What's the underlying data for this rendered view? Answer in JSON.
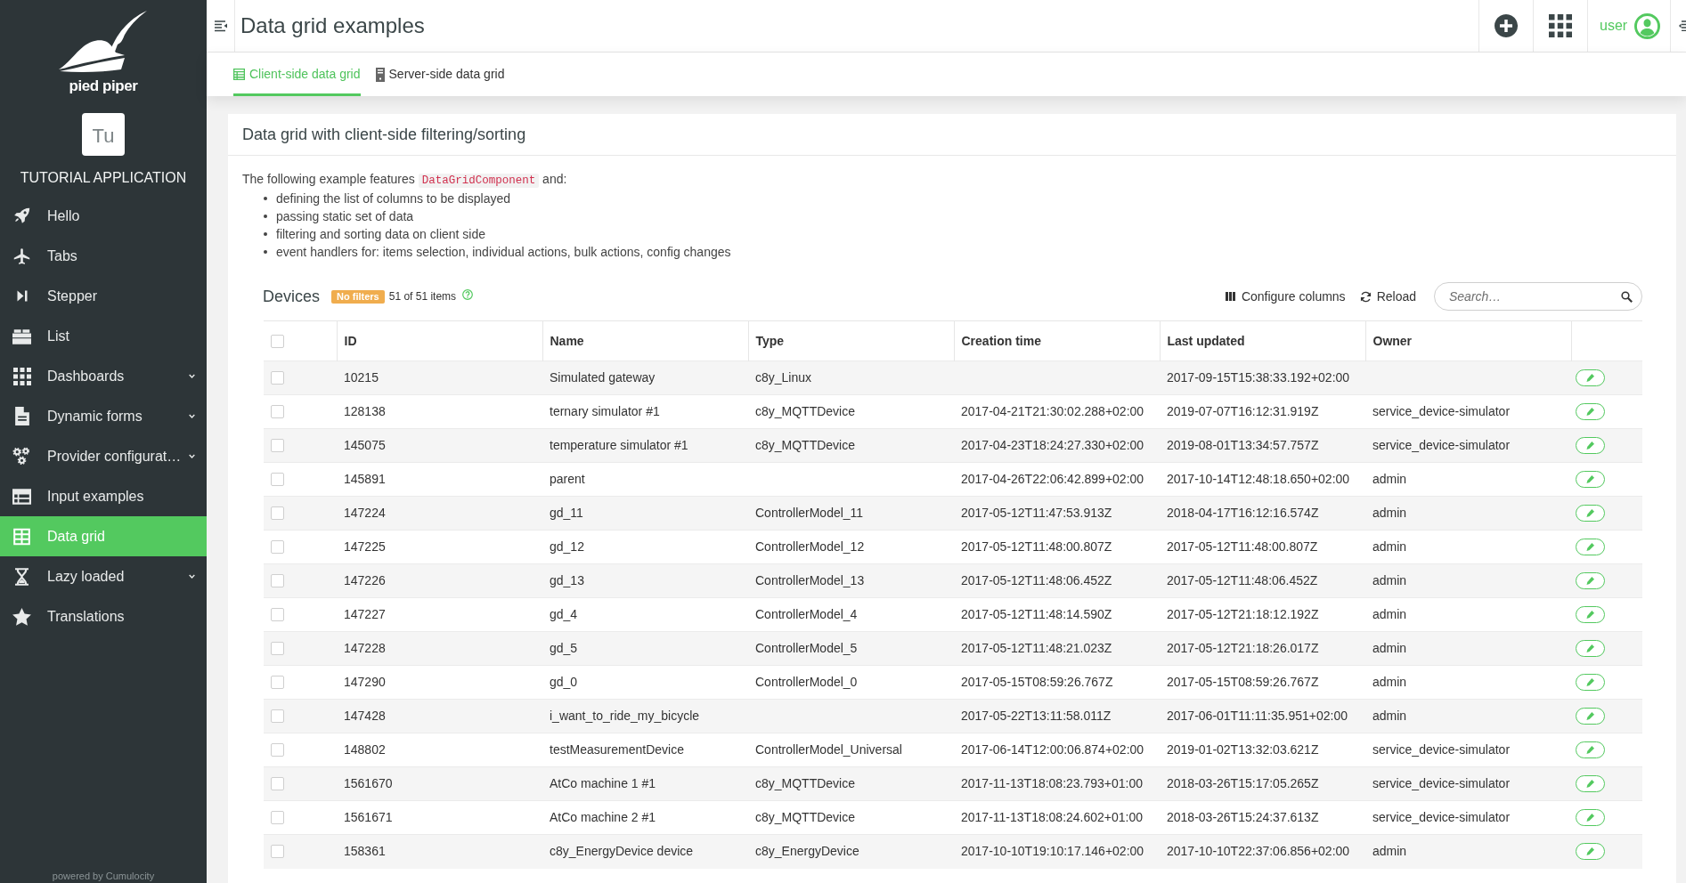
{
  "sidebar": {
    "logo_text": "pied piper",
    "app_initials": "Tu",
    "app_name": "TUTORIAL APPLICATION",
    "items": [
      {
        "label": "Hello",
        "expandable": false,
        "selected": false
      },
      {
        "label": "Tabs",
        "expandable": false,
        "selected": false
      },
      {
        "label": "Stepper",
        "expandable": false,
        "selected": false
      },
      {
        "label": "List",
        "expandable": false,
        "selected": false
      },
      {
        "label": "Dashboards",
        "expandable": true,
        "selected": false
      },
      {
        "label": "Dynamic forms",
        "expandable": true,
        "selected": false
      },
      {
        "label": "Provider configurat…",
        "expandable": true,
        "selected": false
      },
      {
        "label": "Input examples",
        "expandable": false,
        "selected": false
      },
      {
        "label": "Data grid",
        "expandable": false,
        "selected": true
      },
      {
        "label": "Lazy loaded",
        "expandable": true,
        "selected": false
      },
      {
        "label": "Translations",
        "expandable": false,
        "selected": false
      }
    ],
    "footer": "powered by Cumulocity"
  },
  "header": {
    "title": "Data grid examples",
    "user": "user"
  },
  "tabs": [
    {
      "label": "Client-side data grid",
      "selected": true
    },
    {
      "label": "Server-side data grid",
      "selected": false
    }
  ],
  "card": {
    "title": "Data grid with client-side filtering/sorting",
    "intro": {
      "before": "The following example features",
      "code": "DataGridComponent",
      "after": "and:"
    },
    "bullets": [
      "defining the list of columns to be displayed",
      "passing static set of data",
      "filtering and sorting data on client side",
      "event handlers for: items selection, individual actions, bulk actions, config changes"
    ]
  },
  "grid": {
    "title": "Devices",
    "filter_badge": "No filters",
    "count": "51 of 51 items",
    "configure_columns": "Configure columns",
    "reload": "Reload",
    "search": {
      "placeholder": "Search…"
    },
    "select_all_checked": false,
    "columns": [
      "ID",
      "Name",
      "Type",
      "Creation time",
      "Last updated",
      "Owner"
    ],
    "rows": [
      {
        "checked": false,
        "id": "10215",
        "name": "Simulated gateway",
        "type": "c8y_Linux",
        "last_updated": "2017-09-15T15:38:33.192+02:00"
      },
      {
        "checked": false,
        "id": "128138",
        "name": "ternary simulator #1",
        "type": "c8y_MQTTDevice",
        "creation_time": "2017-04-21T21:30:02.288+02:00",
        "last_updated": "2019-07-07T16:12:31.919Z",
        "owner": "service_device-simulator"
      },
      {
        "checked": false,
        "id": "145075",
        "name": "temperature simulator #1",
        "type": "c8y_MQTTDevice",
        "creation_time": "2017-04-23T18:24:27.330+02:00",
        "last_updated": "2019-08-01T13:34:57.757Z",
        "owner": "service_device-simulator"
      },
      {
        "checked": false,
        "id": "145891",
        "name": "parent",
        "creation_time": "2017-04-26T22:06:42.899+02:00",
        "last_updated": "2017-10-14T12:48:18.650+02:00",
        "owner": "admin"
      },
      {
        "checked": false,
        "id": "147224",
        "name": "gd_11",
        "type": "ControllerModel_11",
        "creation_time": "2017-05-12T11:47:53.913Z",
        "last_updated": "2018-04-17T16:12:16.574Z",
        "owner": "admin"
      },
      {
        "checked": false,
        "id": "147225",
        "name": "gd_12",
        "type": "ControllerModel_12",
        "creation_time": "2017-05-12T11:48:00.807Z",
        "last_updated": "2017-05-12T11:48:00.807Z",
        "owner": "admin"
      },
      {
        "checked": false,
        "id": "147226",
        "name": "gd_13",
        "type": "ControllerModel_13",
        "creation_time": "2017-05-12T11:48:06.452Z",
        "last_updated": "2017-05-12T11:48:06.452Z",
        "owner": "admin"
      },
      {
        "checked": false,
        "id": "147227",
        "name": "gd_4",
        "type": "ControllerModel_4",
        "creation_time": "2017-05-12T11:48:14.590Z",
        "last_updated": "2017-05-12T21:18:12.192Z",
        "owner": "admin"
      },
      {
        "checked": false,
        "id": "147228",
        "name": "gd_5",
        "type": "ControllerModel_5",
        "creation_time": "2017-05-12T11:48:21.023Z",
        "last_updated": "2017-05-12T21:18:26.017Z",
        "owner": "admin"
      },
      {
        "checked": false,
        "id": "147290",
        "name": "gd_0",
        "type": "ControllerModel_0",
        "creation_time": "2017-05-15T08:59:26.767Z",
        "last_updated": "2017-05-15T08:59:26.767Z",
        "owner": "admin"
      },
      {
        "checked": false,
        "id": "147428",
        "name": "i_want_to_ride_my_bicycle",
        "creation_time": "2017-05-22T13:11:58.011Z",
        "last_updated": "2017-06-01T11:11:35.951+02:00",
        "owner": "admin"
      },
      {
        "checked": false,
        "id": "148802",
        "name": "testMeasurementDevice",
        "type": "ControllerModel_Universal",
        "creation_time": "2017-06-14T12:00:06.874+02:00",
        "last_updated": "2019-01-02T13:32:03.621Z",
        "owner": "service_device-simulator"
      },
      {
        "checked": false,
        "id": "1561670",
        "name": "AtCo machine 1 #1",
        "type": "c8y_MQTTDevice",
        "creation_time": "2017-11-13T18:08:23.793+01:00",
        "last_updated": "2018-03-26T15:17:05.265Z",
        "owner": "service_device-simulator"
      },
      {
        "checked": false,
        "id": "1561671",
        "name": "AtCo machine 2 #1",
        "type": "c8y_MQTTDevice",
        "creation_time": "2017-11-13T18:08:24.602+01:00",
        "last_updated": "2018-03-26T15:24:37.613Z",
        "owner": "service_device-simulator"
      },
      {
        "checked": false,
        "id": "158361",
        "name": "c8y_EnergyDevice device",
        "type": "c8y_EnergyDevice",
        "creation_time": "2017-10-10T19:10:17.146+02:00",
        "last_updated": "2017-10-10T22:37:06.856+02:00",
        "owner": "admin"
      }
    ]
  }
}
